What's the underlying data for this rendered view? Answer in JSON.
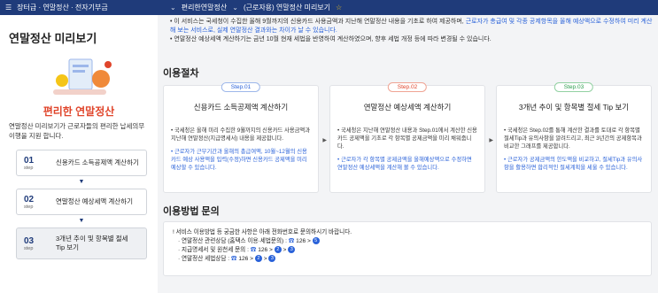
{
  "topbar": {
    "menu_label": "장터급 · 연말정산 · 전자기부금",
    "crumb1": "편리한연말정산",
    "crumb2": "(근로자용) 연말정산 미리보기"
  },
  "sidebar": {
    "title": "연말정산 미리보기",
    "brand": "편리한 연말정산",
    "desc": "연말정산 미리보기가 근로자들의 편리한 납세의무 이행을 지원 합니다.",
    "steps": [
      {
        "num": "01",
        "step": "step",
        "label": "신용카드 소득공제액 계산하기"
      },
      {
        "num": "02",
        "step": "step",
        "label": "연말정산 예상세액 계산하기"
      },
      {
        "num": "03",
        "step": "step",
        "label": "3개년 추이 및 항목별 절세 Tip 보기"
      }
    ]
  },
  "notice": {
    "line1_a": "• 이 서비스는 국세청이 수집한 올해 9월까지의 신용카드 사용금액과 지난해 연말정산 내용을 기초로 하여 제공하며, ",
    "line1_b": "근로자가 총급여 및 각종 공제항목을 올해 예상액으로 수정하여 미리 계산해 보는 서비스로, 실제 연말정산 결과와는 차이가 날 수 있습니다.",
    "line2": "• 연말정산 예상세액 계산하기는 금년 10월 현재 세법을 반영하여 계산하였으며, 향후 세법 개정 등에 따라 변경될 수 있습니다."
  },
  "process_title": "이용절차",
  "cards": [
    {
      "badge": "Step.01",
      "title": "신용카드 소득공제액 계산하기",
      "p1": "국세청은 올해 미리 수집한 9월까지의 신용카드 사용금액과 지난해 연말정산(지급명세서) 내용을 제공합니다.",
      "p2": "근로자가 근무기간과 올해의 총급여액, 10월~12월의 신용카드 예상 사용액을 입력(수정)하면 신용카드 공제액을 미리 예상할 수 있습니다."
    },
    {
      "badge": "Step.02",
      "title": "연말정산 예상세액 계산하기",
      "p1": "국세청은 지난해 연말정산 내용과 Step.01에서 계산한 신용카드 공제액을 기초로 각 항목별 공제금액을 미리 채워줍니다.",
      "p2": "근로자가 각 항목별 공제금액을 올해예상액으로 수정하면 연말정산 예상세액을 계산해 볼 수 있습니다."
    },
    {
      "badge": "Step.03",
      "title": "3개년 추이 및 항목별 절세 Tip 보기",
      "p1": "국세청은 Step.02를 통해 계산한 결과를 토대로 각 항목별 절세Tip과 유의사항을 알려드리고, 최근 3년간의 공제항목과 비교한 그래프를 제공합니다.",
      "p2": "근로자가 공제금액의 한도액을 비교하고, 절세Tip과 유의사항을 활용하면 합리적인 절세계획을 세울 수 있습니다."
    }
  ],
  "inquiry_title": "이용방법 문의",
  "inquiry": {
    "intro": "! 서비스 이용방법 등 궁금한 사항은 아래 전화번호로 문의하시기 바랍니다.",
    "line1_label": "· 연말정산 관련상담 (홈택스 이용·세법문의) : ",
    "line1_tel": "126",
    "line1_path": [
      "5"
    ],
    "line2_label": "· 지급명세서 및 원천세 문의 : ",
    "line2_tel": "126",
    "line2_path": [
      "2",
      "3"
    ],
    "line3_label": "· 연말정산 세법상담 : ",
    "line3_tel": "126",
    "line3_path": [
      "2",
      "3"
    ]
  },
  "colors": {
    "navy": "#1f3b7a",
    "blue": "#2a62d9",
    "red": "#e0452b",
    "green": "#2a9d4b"
  }
}
